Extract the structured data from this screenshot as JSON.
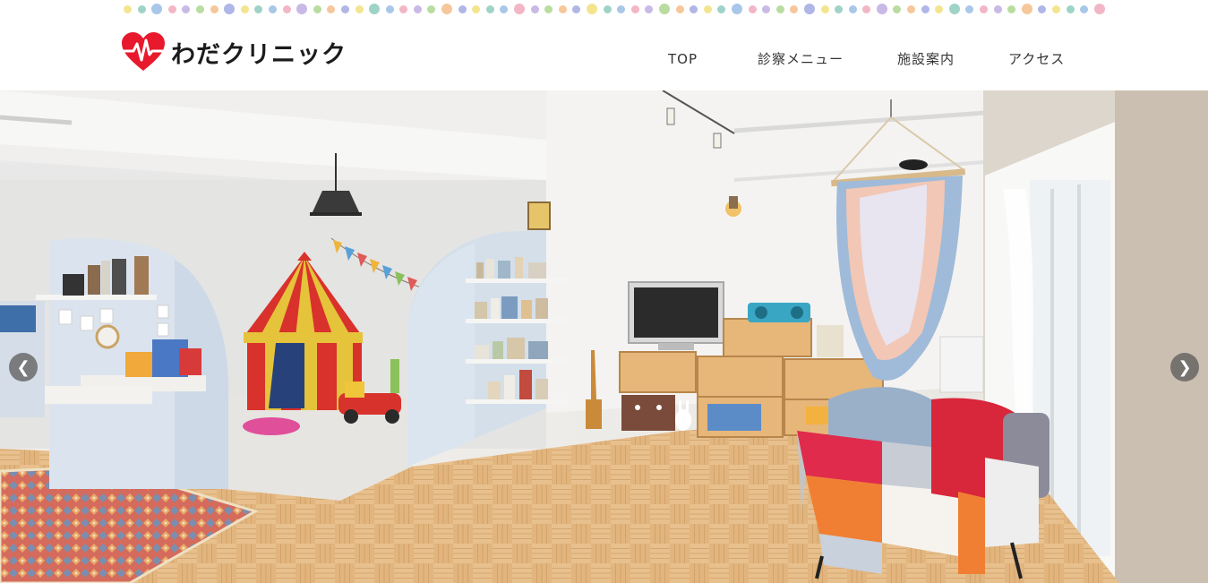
{
  "site": {
    "logo_text": "わだクリニック",
    "logo_icon": "heart-pulse-icon",
    "brand_color": "#e8192c"
  },
  "nav": {
    "items": [
      {
        "label": "TOP"
      },
      {
        "label": "診察メニュー"
      },
      {
        "label": "施設案内"
      },
      {
        "label": "アクセス"
      }
    ]
  },
  "slider": {
    "prev_icon": "chevron-left-icon",
    "next_icon": "chevron-right-icon",
    "prev_glyph": "❮",
    "next_glyph": "❯",
    "image": "kids-playroom-photo"
  },
  "decoration": {
    "dot_colors": [
      "#f3e58f",
      "#9fd3c8",
      "#a9c7e8",
      "#f2b6c6",
      "#c9b9e6",
      "#b9dca0",
      "#f6c79a",
      "#b0b6e6"
    ]
  }
}
